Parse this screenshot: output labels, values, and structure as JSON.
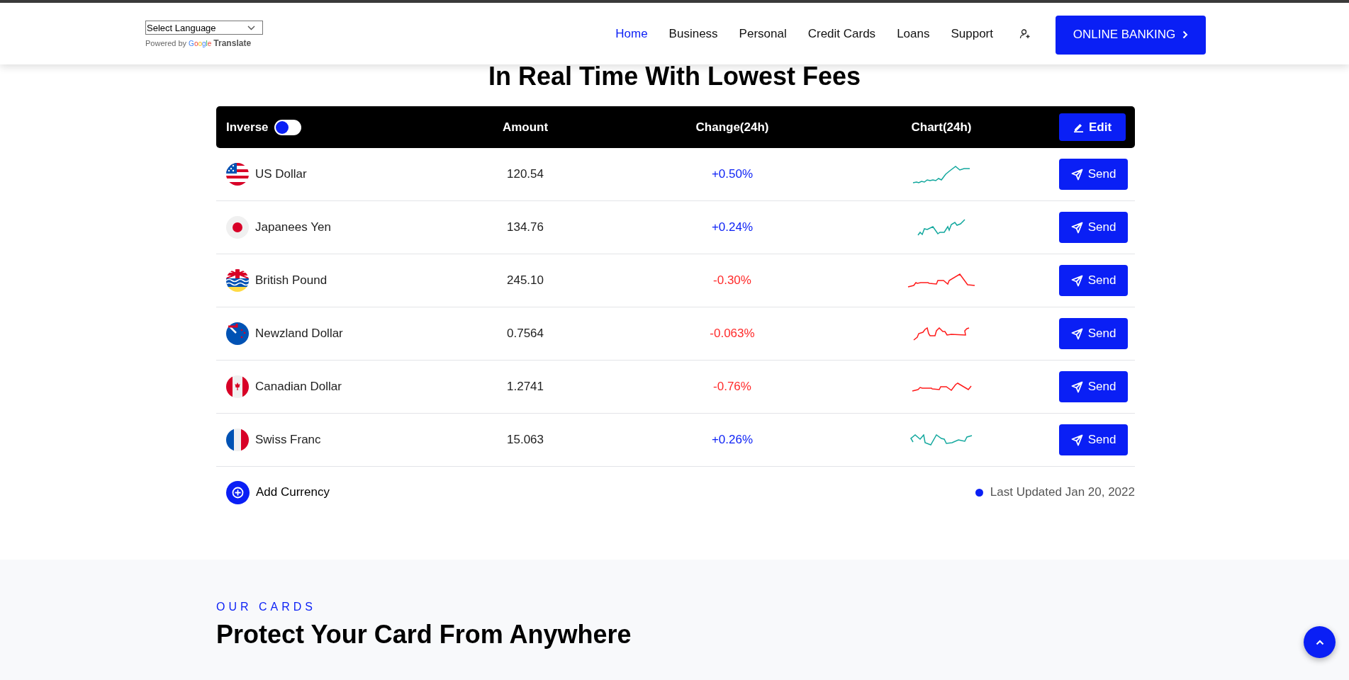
{
  "header": {
    "language_select": {
      "value": "Select Language"
    },
    "powered_by": "Powered by",
    "google": "Google",
    "translate": "Translate",
    "nav": [
      {
        "label": "Home",
        "selected": true
      },
      {
        "label": "Business",
        "selected": false
      },
      {
        "label": "Personal",
        "selected": false
      },
      {
        "label": "Credit Cards",
        "selected": false
      },
      {
        "label": "Loans",
        "selected": false
      },
      {
        "label": "Support",
        "selected": false
      }
    ],
    "cta": "ONLINE BANKING"
  },
  "section_title": "In Real Time With Lowest Fees",
  "table": {
    "inverse": {
      "label": "Inverse",
      "on": false
    },
    "columns": [
      "Amount",
      "Change(24h)",
      "Chart(24h)"
    ],
    "edit_button": "Edit",
    "rows": [
      {
        "name": "US Dollar",
        "amount": "120.54",
        "change": {
          "text": "+0.50%",
          "color": "#0a1ff5"
        },
        "chart": {
          "color": "#13a89e"
        },
        "action": "Send"
      },
      {
        "name": "Japanees Yen",
        "amount": "134.76",
        "change": {
          "text": "+0.24%",
          "color": "#0a1ff5"
        },
        "chart": {
          "color": "#13a89e"
        },
        "action": "Send"
      },
      {
        "name": "British Pound",
        "amount": "245.10",
        "change": {
          "text": "-0.30%",
          "color": "#ff2a2a"
        },
        "chart": {
          "color": "#ff1a1a"
        },
        "action": "Send"
      },
      {
        "name": "Newzland Dollar",
        "amount": "0.7564",
        "change": {
          "text": "-0.063%",
          "color": "#ff2a2a"
        },
        "chart": {
          "color": "#ff1a1a"
        },
        "action": "Send"
      },
      {
        "name": "Canadian Dollar",
        "amount": "1.2741",
        "change": {
          "text": "-0.76%",
          "color": "#ff2a2a"
        },
        "chart": {
          "color": "#ff1a1a"
        },
        "action": "Send"
      },
      {
        "name": "Swiss Franc",
        "amount": "15.063",
        "change": {
          "text": "+0.26%",
          "color": "#0a1ff5"
        },
        "chart": {
          "color": "#13a89e"
        },
        "action": "Send"
      }
    ],
    "add_currency": "Add Currency",
    "last_updated": "Last Updated Jan 20, 2022"
  },
  "cards_section": {
    "eyebrow": "OUR CARDS",
    "title": "Protect Your Card From Anywhere"
  }
}
